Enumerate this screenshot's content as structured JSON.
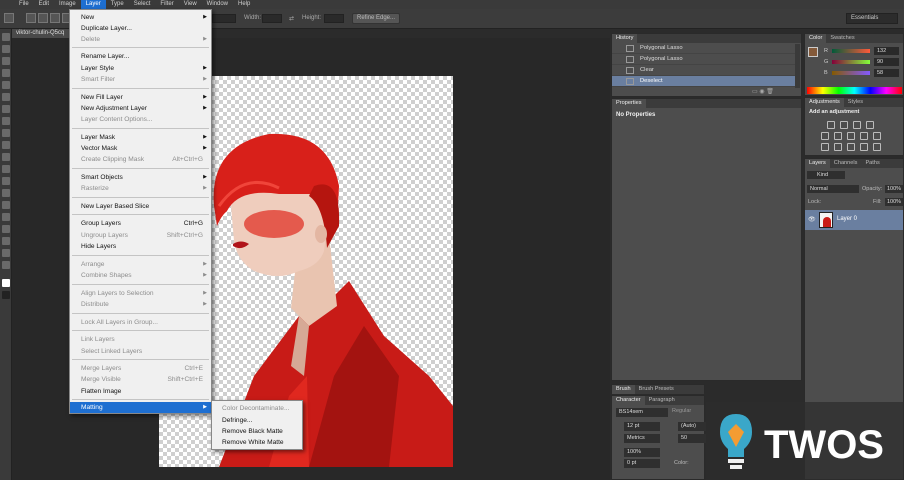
{
  "menubar": {
    "items": [
      "File",
      "Edit",
      "Image",
      "Layer",
      "Type",
      "Select",
      "Filter",
      "View",
      "Window",
      "Help"
    ]
  },
  "optionsbar": {
    "width_label": "Width:",
    "height_label": "Height:",
    "refine_button": "Refine Edge...",
    "workspace": "Essentials"
  },
  "document": {
    "tab_title": "viktor-chulin-Q5cq"
  },
  "layer_menu": {
    "new": "New",
    "duplicate_layer": "Duplicate Layer...",
    "delete": "Delete",
    "rename_layer": "Rename Layer...",
    "layer_style": "Layer Style",
    "smart_filter": "Smart Filter",
    "new_fill_layer": "New Fill Layer",
    "new_adjustment_layer": "New Adjustment Layer",
    "layer_content_options": "Layer Content Options...",
    "layer_mask": "Layer Mask",
    "vector_mask": "Vector Mask",
    "create_clipping_mask": "Create Clipping Mask",
    "create_clipping_mask_sc": "Alt+Ctrl+G",
    "smart_objects": "Smart Objects",
    "rasterize": "Rasterize",
    "new_layer_based_slice": "New Layer Based Slice",
    "group_layers": "Group Layers",
    "group_layers_sc": "Ctrl+G",
    "ungroup_layers": "Ungroup Layers",
    "ungroup_layers_sc": "Shift+Ctrl+G",
    "hide_layers": "Hide Layers",
    "arrange": "Arrange",
    "combine_shapes": "Combine Shapes",
    "align_layers": "Align Layers to Selection",
    "distribute": "Distribute",
    "lock_all_layers": "Lock All Layers in Group...",
    "link_layers": "Link Layers",
    "select_linked_layers": "Select Linked Layers",
    "merge_layers": "Merge Layers",
    "merge_layers_sc": "Ctrl+E",
    "merge_visible": "Merge Visible",
    "merge_visible_sc": "Shift+Ctrl+E",
    "flatten_image": "Flatten Image",
    "matting": "Matting"
  },
  "matting_submenu": {
    "color_decontaminate": "Color Decontaminate...",
    "defringe": "Defringe...",
    "remove_black_matte": "Remove Black Matte",
    "remove_white_matte": "Remove White Matte"
  },
  "history": {
    "tab": "History",
    "items": [
      "Polygonal Lasso",
      "Polygonal Lasso",
      "Clear",
      "Deselect"
    ]
  },
  "properties": {
    "tab": "Properties",
    "text": "No Properties"
  },
  "color": {
    "tabs": [
      "Color",
      "Swatches"
    ],
    "r": "132",
    "g": "90",
    "b": "58",
    "r_label": "R",
    "g_label": "G",
    "b_label": "B",
    "swatch": "#845a3a"
  },
  "adjustments": {
    "tabs": [
      "Adjustments",
      "Styles"
    ],
    "title": "Add an adjustment"
  },
  "layers": {
    "tabs": [
      "Layers",
      "Channels",
      "Paths"
    ],
    "kind": "Kind",
    "blend_mode": "Normal",
    "opacity_label": "Opacity:",
    "opacity": "100%",
    "lock_label": "Lock:",
    "fill_label": "Fill:",
    "fill": "100%",
    "layer_name": "Layer 0"
  },
  "brush": {
    "tabs": [
      "Brush",
      "Brush Presets"
    ]
  },
  "character": {
    "tabs": [
      "Character",
      "Paragraph"
    ],
    "font": "BS14sem",
    "style": "Regular",
    "size": "12 pt",
    "leading": "(Auto)",
    "kerning": "Metrics",
    "tracking": "50",
    "vscale": "100%",
    "baseline": "0 pt",
    "color_label": "Color:"
  },
  "watermark": {
    "text": "TWOS"
  }
}
